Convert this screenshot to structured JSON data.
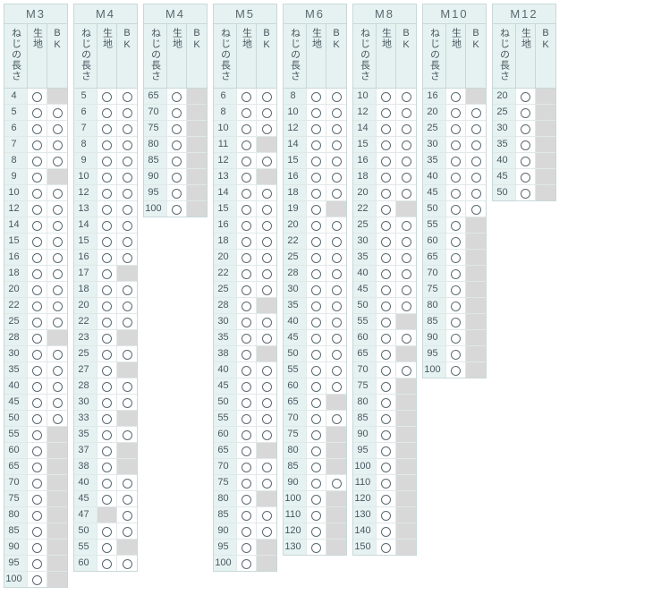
{
  "headers": {
    "length": "ねじの長さ",
    "col_a": "生地",
    "col_b": "BK"
  },
  "groups": [
    {
      "title": "M3",
      "rows": [
        {
          "len": "4",
          "a": 1,
          "b": 0
        },
        {
          "len": "5",
          "a": 1,
          "b": 1
        },
        {
          "len": "6",
          "a": 1,
          "b": 1
        },
        {
          "len": "7",
          "a": 1,
          "b": 1
        },
        {
          "len": "8",
          "a": 1,
          "b": 1
        },
        {
          "len": "9",
          "a": 1,
          "b": 0
        },
        {
          "len": "10",
          "a": 1,
          "b": 1
        },
        {
          "len": "12",
          "a": 1,
          "b": 1
        },
        {
          "len": "14",
          "a": 1,
          "b": 1
        },
        {
          "len": "15",
          "a": 1,
          "b": 1
        },
        {
          "len": "16",
          "a": 1,
          "b": 1
        },
        {
          "len": "18",
          "a": 1,
          "b": 1
        },
        {
          "len": "20",
          "a": 1,
          "b": 1
        },
        {
          "len": "22",
          "a": 1,
          "b": 1
        },
        {
          "len": "25",
          "a": 1,
          "b": 1
        },
        {
          "len": "28",
          "a": 1,
          "b": 0
        },
        {
          "len": "30",
          "a": 1,
          "b": 1
        },
        {
          "len": "35",
          "a": 1,
          "b": 1
        },
        {
          "len": "40",
          "a": 1,
          "b": 1
        },
        {
          "len": "45",
          "a": 1,
          "b": 1
        },
        {
          "len": "50",
          "a": 1,
          "b": 1
        },
        {
          "len": "55",
          "a": 1,
          "b": 0
        },
        {
          "len": "60",
          "a": 1,
          "b": 0
        },
        {
          "len": "65",
          "a": 1,
          "b": 0
        },
        {
          "len": "70",
          "a": 1,
          "b": 0
        },
        {
          "len": "75",
          "a": 1,
          "b": 0
        },
        {
          "len": "80",
          "a": 1,
          "b": 0
        },
        {
          "len": "85",
          "a": 1,
          "b": 0
        },
        {
          "len": "90",
          "a": 1,
          "b": 0
        },
        {
          "len": "95",
          "a": 1,
          "b": 0
        },
        {
          "len": "100",
          "a": 1,
          "b": 0
        }
      ]
    },
    {
      "title": "M4",
      "rows": [
        {
          "len": "5",
          "a": 1,
          "b": 1
        },
        {
          "len": "6",
          "a": 1,
          "b": 1
        },
        {
          "len": "7",
          "a": 1,
          "b": 1
        },
        {
          "len": "8",
          "a": 1,
          "b": 1
        },
        {
          "len": "9",
          "a": 1,
          "b": 1
        },
        {
          "len": "10",
          "a": 1,
          "b": 1
        },
        {
          "len": "12",
          "a": 1,
          "b": 1
        },
        {
          "len": "13",
          "a": 1,
          "b": 1
        },
        {
          "len": "14",
          "a": 1,
          "b": 1
        },
        {
          "len": "15",
          "a": 1,
          "b": 1
        },
        {
          "len": "16",
          "a": 1,
          "b": 1
        },
        {
          "len": "17",
          "a": 1,
          "b": 0
        },
        {
          "len": "18",
          "a": 1,
          "b": 1
        },
        {
          "len": "20",
          "a": 1,
          "b": 1
        },
        {
          "len": "22",
          "a": 1,
          "b": 1
        },
        {
          "len": "23",
          "a": 1,
          "b": 0
        },
        {
          "len": "25",
          "a": 1,
          "b": 1
        },
        {
          "len": "27",
          "a": 1,
          "b": 0
        },
        {
          "len": "28",
          "a": 1,
          "b": 1
        },
        {
          "len": "30",
          "a": 1,
          "b": 1
        },
        {
          "len": "33",
          "a": 1,
          "b": 0
        },
        {
          "len": "35",
          "a": 1,
          "b": 1
        },
        {
          "len": "37",
          "a": 1,
          "b": 0
        },
        {
          "len": "38",
          "a": 1,
          "b": 0
        },
        {
          "len": "40",
          "a": 1,
          "b": 1
        },
        {
          "len": "45",
          "a": 1,
          "b": 1
        },
        {
          "len": "47",
          "a": 0,
          "b": 1
        },
        {
          "len": "50",
          "a": 1,
          "b": 1
        },
        {
          "len": "55",
          "a": 1,
          "b": 0
        },
        {
          "len": "60",
          "a": 1,
          "b": 1
        }
      ]
    },
    {
      "title": "M4",
      "rows": [
        {
          "len": "65",
          "a": 1,
          "b": 0
        },
        {
          "len": "70",
          "a": 1,
          "b": 0
        },
        {
          "len": "75",
          "a": 1,
          "b": 0
        },
        {
          "len": "80",
          "a": 1,
          "b": 0
        },
        {
          "len": "85",
          "a": 1,
          "b": 0
        },
        {
          "len": "90",
          "a": 1,
          "b": 0
        },
        {
          "len": "95",
          "a": 1,
          "b": 0
        },
        {
          "len": "100",
          "a": 1,
          "b": 0
        }
      ]
    },
    {
      "title": "M5",
      "rows": [
        {
          "len": "6",
          "a": 1,
          "b": 1
        },
        {
          "len": "8",
          "a": 1,
          "b": 1
        },
        {
          "len": "10",
          "a": 1,
          "b": 1
        },
        {
          "len": "11",
          "a": 1,
          "b": 0
        },
        {
          "len": "12",
          "a": 1,
          "b": 1
        },
        {
          "len": "13",
          "a": 1,
          "b": 0
        },
        {
          "len": "14",
          "a": 1,
          "b": 1
        },
        {
          "len": "15",
          "a": 1,
          "b": 1
        },
        {
          "len": "16",
          "a": 1,
          "b": 1
        },
        {
          "len": "18",
          "a": 1,
          "b": 1
        },
        {
          "len": "20",
          "a": 1,
          "b": 1
        },
        {
          "len": "22",
          "a": 1,
          "b": 1
        },
        {
          "len": "25",
          "a": 1,
          "b": 1
        },
        {
          "len": "28",
          "a": 1,
          "b": 0
        },
        {
          "len": "30",
          "a": 1,
          "b": 1
        },
        {
          "len": "35",
          "a": 1,
          "b": 1
        },
        {
          "len": "38",
          "a": 1,
          "b": 0
        },
        {
          "len": "40",
          "a": 1,
          "b": 1
        },
        {
          "len": "45",
          "a": 1,
          "b": 1
        },
        {
          "len": "50",
          "a": 1,
          "b": 1
        },
        {
          "len": "55",
          "a": 1,
          "b": 1
        },
        {
          "len": "60",
          "a": 1,
          "b": 1
        },
        {
          "len": "65",
          "a": 1,
          "b": 0
        },
        {
          "len": "70",
          "a": 1,
          "b": 1
        },
        {
          "len": "75",
          "a": 1,
          "b": 1
        },
        {
          "len": "80",
          "a": 1,
          "b": 0
        },
        {
          "len": "85",
          "a": 1,
          "b": 1
        },
        {
          "len": "90",
          "a": 1,
          "b": 1
        },
        {
          "len": "95",
          "a": 1,
          "b": 0
        },
        {
          "len": "100",
          "a": 1,
          "b": 0
        }
      ]
    },
    {
      "title": "M6",
      "rows": [
        {
          "len": "8",
          "a": 1,
          "b": 1
        },
        {
          "len": "10",
          "a": 1,
          "b": 1
        },
        {
          "len": "12",
          "a": 1,
          "b": 1
        },
        {
          "len": "14",
          "a": 1,
          "b": 1
        },
        {
          "len": "15",
          "a": 1,
          "b": 1
        },
        {
          "len": "16",
          "a": 1,
          "b": 1
        },
        {
          "len": "18",
          "a": 1,
          "b": 1
        },
        {
          "len": "19",
          "a": 1,
          "b": 0
        },
        {
          "len": "20",
          "a": 1,
          "b": 1
        },
        {
          "len": "22",
          "a": 1,
          "b": 1
        },
        {
          "len": "25",
          "a": 1,
          "b": 1
        },
        {
          "len": "28",
          "a": 1,
          "b": 1
        },
        {
          "len": "30",
          "a": 1,
          "b": 1
        },
        {
          "len": "35",
          "a": 1,
          "b": 1
        },
        {
          "len": "40",
          "a": 1,
          "b": 1
        },
        {
          "len": "45",
          "a": 1,
          "b": 1
        },
        {
          "len": "50",
          "a": 1,
          "b": 1
        },
        {
          "len": "55",
          "a": 1,
          "b": 1
        },
        {
          "len": "60",
          "a": 1,
          "b": 1
        },
        {
          "len": "65",
          "a": 1,
          "b": 0
        },
        {
          "len": "70",
          "a": 1,
          "b": 1
        },
        {
          "len": "75",
          "a": 1,
          "b": 0
        },
        {
          "len": "80",
          "a": 1,
          "b": 0
        },
        {
          "len": "85",
          "a": 1,
          "b": 0
        },
        {
          "len": "90",
          "a": 1,
          "b": 1
        },
        {
          "len": "100",
          "a": 1,
          "b": 0
        },
        {
          "len": "110",
          "a": 1,
          "b": 0
        },
        {
          "len": "120",
          "a": 1,
          "b": 0
        },
        {
          "len": "130",
          "a": 1,
          "b": 0
        }
      ]
    },
    {
      "title": "M8",
      "rows": [
        {
          "len": "10",
          "a": 1,
          "b": 1
        },
        {
          "len": "12",
          "a": 1,
          "b": 1
        },
        {
          "len": "14",
          "a": 1,
          "b": 1
        },
        {
          "len": "15",
          "a": 1,
          "b": 1
        },
        {
          "len": "16",
          "a": 1,
          "b": 1
        },
        {
          "len": "18",
          "a": 1,
          "b": 1
        },
        {
          "len": "20",
          "a": 1,
          "b": 1
        },
        {
          "len": "22",
          "a": 1,
          "b": 0
        },
        {
          "len": "25",
          "a": 1,
          "b": 1
        },
        {
          "len": "30",
          "a": 1,
          "b": 1
        },
        {
          "len": "35",
          "a": 1,
          "b": 1
        },
        {
          "len": "40",
          "a": 1,
          "b": 1
        },
        {
          "len": "45",
          "a": 1,
          "b": 1
        },
        {
          "len": "50",
          "a": 1,
          "b": 1
        },
        {
          "len": "55",
          "a": 1,
          "b": 0
        },
        {
          "len": "60",
          "a": 1,
          "b": 1
        },
        {
          "len": "65",
          "a": 1,
          "b": 0
        },
        {
          "len": "70",
          "a": 1,
          "b": 1
        },
        {
          "len": "75",
          "a": 1,
          "b": 0
        },
        {
          "len": "80",
          "a": 1,
          "b": 0
        },
        {
          "len": "85",
          "a": 1,
          "b": 0
        },
        {
          "len": "90",
          "a": 1,
          "b": 0
        },
        {
          "len": "95",
          "a": 1,
          "b": 0
        },
        {
          "len": "100",
          "a": 1,
          "b": 0
        },
        {
          "len": "110",
          "a": 1,
          "b": 0
        },
        {
          "len": "120",
          "a": 1,
          "b": 0
        },
        {
          "len": "130",
          "a": 1,
          "b": 0
        },
        {
          "len": "140",
          "a": 1,
          "b": 0
        },
        {
          "len": "150",
          "a": 1,
          "b": 0
        }
      ]
    },
    {
      "title": "M10",
      "rows": [
        {
          "len": "16",
          "a": 1,
          "b": 0
        },
        {
          "len": "20",
          "a": 1,
          "b": 1
        },
        {
          "len": "25",
          "a": 1,
          "b": 1
        },
        {
          "len": "30",
          "a": 1,
          "b": 1
        },
        {
          "len": "35",
          "a": 1,
          "b": 1
        },
        {
          "len": "40",
          "a": 1,
          "b": 1
        },
        {
          "len": "45",
          "a": 1,
          "b": 1
        },
        {
          "len": "50",
          "a": 1,
          "b": 1
        },
        {
          "len": "55",
          "a": 1,
          "b": 0
        },
        {
          "len": "60",
          "a": 1,
          "b": 0
        },
        {
          "len": "65",
          "a": 1,
          "b": 0
        },
        {
          "len": "70",
          "a": 1,
          "b": 0
        },
        {
          "len": "75",
          "a": 1,
          "b": 0
        },
        {
          "len": "80",
          "a": 1,
          "b": 0
        },
        {
          "len": "85",
          "a": 1,
          "b": 0
        },
        {
          "len": "90",
          "a": 1,
          "b": 0
        },
        {
          "len": "95",
          "a": 1,
          "b": 0
        },
        {
          "len": "100",
          "a": 1,
          "b": 0
        }
      ]
    },
    {
      "title": "M12",
      "rows": [
        {
          "len": "20",
          "a": 1,
          "b": 0
        },
        {
          "len": "25",
          "a": 1,
          "b": 0
        },
        {
          "len": "30",
          "a": 1,
          "b": 0
        },
        {
          "len": "35",
          "a": 1,
          "b": 0
        },
        {
          "len": "40",
          "a": 1,
          "b": 0
        },
        {
          "len": "45",
          "a": 1,
          "b": 0
        },
        {
          "len": "50",
          "a": 1,
          "b": 0
        }
      ]
    }
  ]
}
